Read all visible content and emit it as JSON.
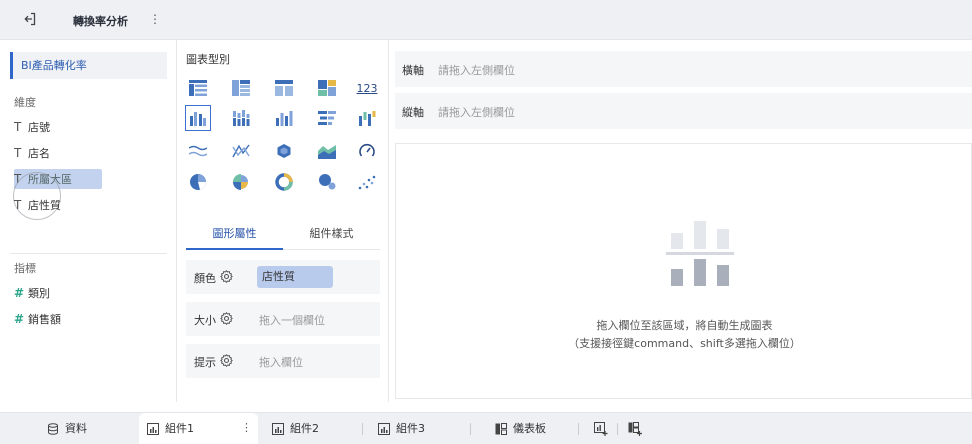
{
  "header": {
    "title": "轉換率分析",
    "more_icon": "⋮"
  },
  "left_panel": {
    "dataset": "BI產品轉化率",
    "dimensions_label": "維度",
    "dimensions": [
      "店號",
      "店名",
      "所屬大區",
      "店性質"
    ],
    "measures_label": "指標",
    "measures": [
      "類別",
      "銷售額"
    ],
    "dimension_type_glyph": "T",
    "measure_type_glyph": "#"
  },
  "chart_panel": {
    "header": "圖表型別",
    "number_chart_label": "123",
    "chart_types": [
      "table-icon",
      "cross-table-icon",
      "detail-table-icon",
      "treemap-icon",
      "number-card-icon",
      "grouped-bar-icon",
      "stacked-bar-icon",
      "column-bar-icon",
      "horizontal-bar-icon",
      "range-bar-icon",
      "line-icon",
      "radar-icon",
      "hexagon-map-icon",
      "area-icon",
      "gauge-icon",
      "pie-icon",
      "rose-pie-icon",
      "donut-icon",
      "bubble-icon",
      "scatter-icon"
    ],
    "selected_index": 5
  },
  "properties": {
    "tabs": [
      "圖形屬性",
      "組件樣式"
    ],
    "active_tab": 0,
    "color_label": "顏色",
    "color_value": "店性質",
    "size_label": "大小",
    "size_placeholder": "拖入一個欄位",
    "tooltip_label": "提示",
    "tooltip_placeholder": "拖入欄位"
  },
  "axes": {
    "x_label": "橫軸",
    "x_placeholder": "請拖入左側欄位",
    "y_label": "縱軸",
    "y_placeholder": "請拖入左側欄位"
  },
  "canvas": {
    "message": "拖入欄位至該區域，將自動生成圖表",
    "hint": "（支援接徑鍵command、shift多選拖入欄位）"
  },
  "bottom_tabs": {
    "data": "資料",
    "component1": "組件1",
    "component2": "組件2",
    "component3": "組件3",
    "dashboard": "儀表板",
    "menu_icon": "⋮"
  },
  "colors": {
    "accent": "#2f66c9",
    "chip": "#b9cbec",
    "measure": "#2aa58a"
  }
}
